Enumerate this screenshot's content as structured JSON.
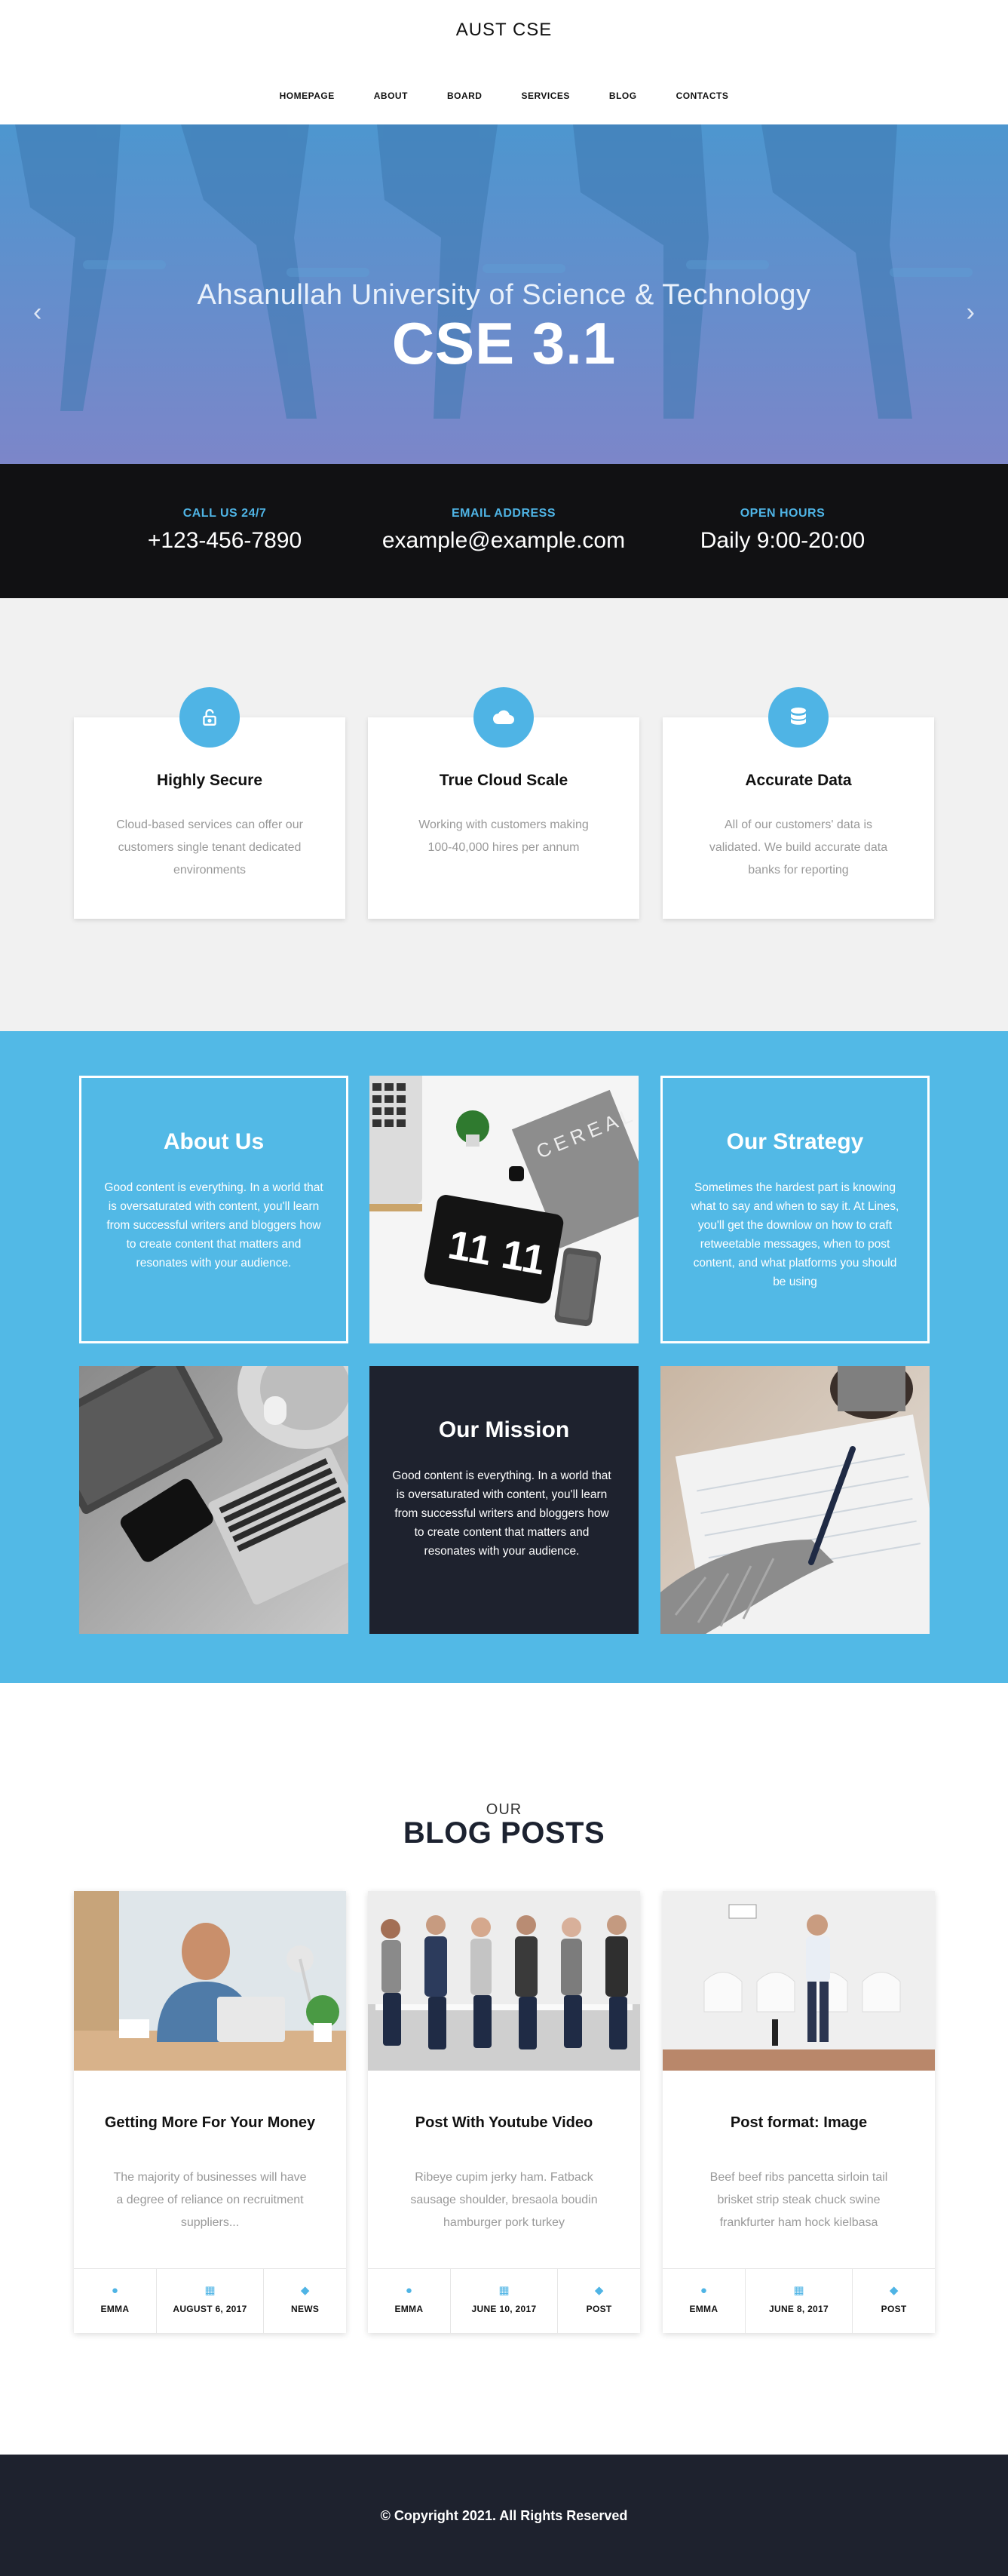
{
  "header": {
    "site_title": "AUST CSE",
    "nav": [
      "HOMEPAGE",
      "ABOUT",
      "BOARD",
      "SERVICES",
      "BLOG",
      "CONTACTS"
    ]
  },
  "hero": {
    "subtitle": "Ahsanullah University of Science & Technology",
    "title": "CSE 3.1",
    "prev_icon": "chevron-left",
    "next_icon": "chevron-right"
  },
  "contact": [
    {
      "label": "CALL US 24/7",
      "value": "+123-456-7890"
    },
    {
      "label": "EMAIL ADDRESS",
      "value": "example@example.com"
    },
    {
      "label": "OPEN HOURS",
      "value": "Daily 9:00-20:00"
    }
  ],
  "features": [
    {
      "icon": "unlock-icon",
      "title": "Highly Secure",
      "text": "Cloud-based services can offer our customers single tenant dedicated environments"
    },
    {
      "icon": "cloud-icon",
      "title": "True Cloud Scale",
      "text": "Working with customers making 100-40,000 hires per annum"
    },
    {
      "icon": "database-icon",
      "title": "Accurate Data",
      "text": "All of our customers' data is validated. We build accurate data banks for reporting"
    }
  ],
  "about": {
    "about_us": {
      "title": "About Us",
      "text": "Good content is everything. In a world that is oversaturated with content, you'll learn from successful writers and bloggers how to create content that matters and resonates with your audience."
    },
    "strategy": {
      "title": "Our Strategy",
      "text": "Sometimes the hardest part is knowing what to say and when to say it. At Lines, you'll get the downlow on how to craft retweetable messages, when to post content, and what platforms you should be using"
    },
    "mission": {
      "title": "Our Mission",
      "text": "Good content is everything. In a world that is oversaturated with content, you'll learn from successful writers and bloggers how to create content that matters and resonates with your audience."
    },
    "clock_text": "11 11",
    "magazine_text": "CEREAL"
  },
  "blog": {
    "eyebrow": "OUR",
    "title": "BLOG POSTS",
    "posts": [
      {
        "title": "Getting More For Your Money",
        "excerpt": "The majority of businesses will have a degree of reliance on recruitment suppliers...",
        "author": "EMMA",
        "date": "AUGUST 6, 2017",
        "tag": "NEWS"
      },
      {
        "title": "Post With Youtube Video",
        "excerpt": "Ribeye cupim jerky ham. Fatback sausage shoulder, bresaola boudin hamburger pork turkey",
        "author": "EMMA",
        "date": "JUNE 10, 2017",
        "tag": "POST"
      },
      {
        "title": "Post format: Image",
        "excerpt": "Beef beef ribs pancetta sirloin tail brisket strip steak chuck swine frankfurter ham hock kielbasa",
        "author": "EMMA",
        "date": "JUNE 8, 2017",
        "tag": "POST"
      }
    ]
  },
  "footer": {
    "copyright": "© Copyright 2021. All Rights Reserved"
  },
  "colors": {
    "accent": "#4fb4e5",
    "about_bg": "#52b9e6",
    "dark": "#1e222e",
    "contact_bg": "#111113",
    "features_bg": "#f1f1f1"
  }
}
